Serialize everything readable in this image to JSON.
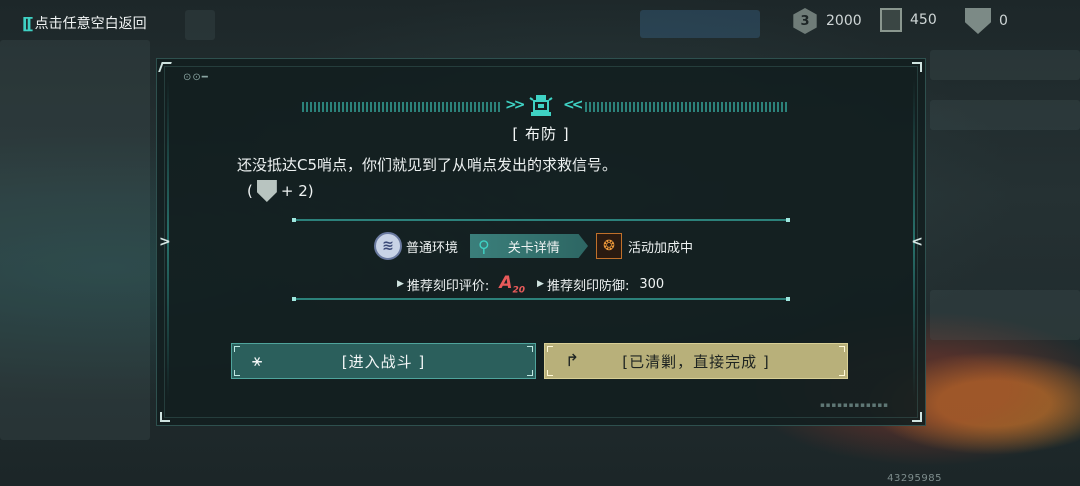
{
  "top_bar": {
    "back_label": "点击任意空白返回",
    "resources": [
      {
        "icon": "bronze-coin-icon",
        "glyph": "3",
        "value": "2000"
      },
      {
        "icon": "card-icon",
        "glyph": "",
        "value": "450"
      },
      {
        "icon": "shield-token-icon",
        "glyph": "",
        "value": "0"
      }
    ]
  },
  "panel": {
    "title": "[ 布防 ]",
    "description": "还没抵达C5哨点，你们就见到了从哨点发出的求救信号。",
    "reward": {
      "open": "(",
      "amount": "+ 2)"
    },
    "environment": "普通环境",
    "detail_tab": "关卡详情",
    "event": "活动加成中",
    "rec_rating_label": "推荐刻印评价:",
    "rank_letter": "A",
    "rank_num": "20",
    "rec_defense_label": "推荐刻印防御:",
    "rec_defense_value": "300",
    "fight_label": "[进入战斗 ]",
    "skip_label": "[已清剿，直接完成 ]"
  },
  "footer": {
    "uid": "43295985"
  }
}
